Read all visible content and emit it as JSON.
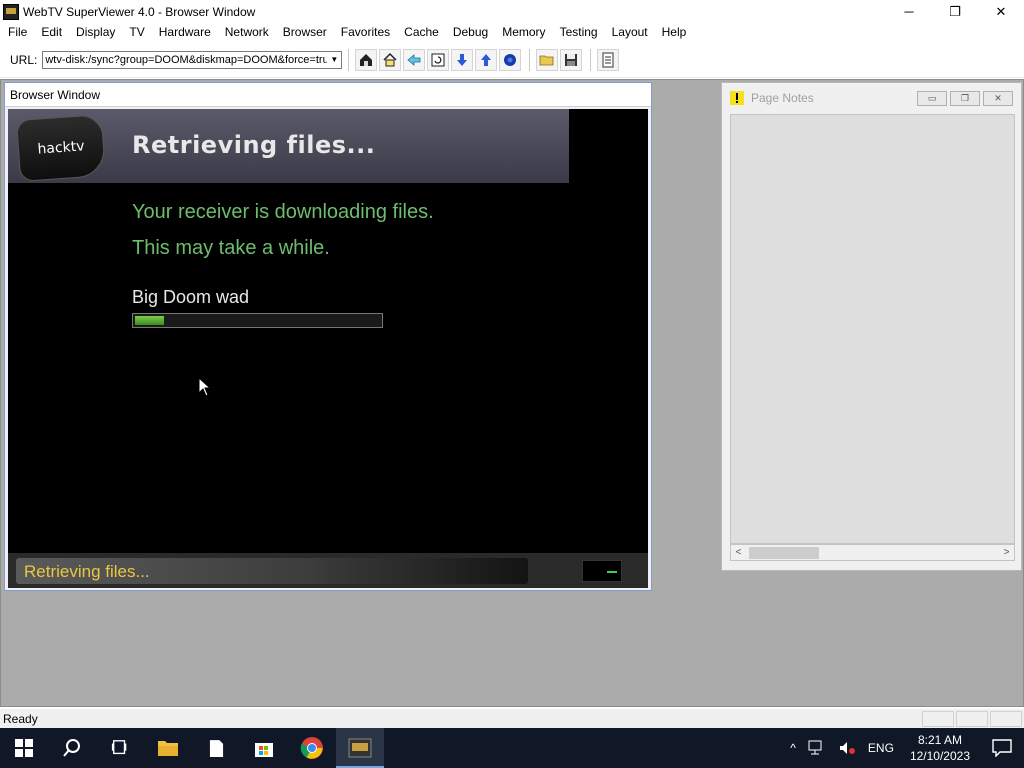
{
  "window": {
    "title": "WebTV SuperViewer 4.0 - Browser Window",
    "minimize_glyph": "─",
    "maximize_glyph": "❐",
    "close_glyph": "✕"
  },
  "menu": [
    "File",
    "Edit",
    "Display",
    "TV",
    "Hardware",
    "Network",
    "Browser",
    "Favorites",
    "Cache",
    "Debug",
    "Memory",
    "Testing",
    "Layout",
    "Help"
  ],
  "toolbar": {
    "url_label": "URL:",
    "url_value": "wtv-disk:/sync?group=DOOM&diskmap=DOOM&force=true",
    "icons": [
      "home-folder-icon",
      "home-icon",
      "back-arrow-icon",
      "reload-icon",
      "down-arrow-icon",
      "up-arrow-icon",
      "stop-icon",
      "open-folder-icon",
      "save-icon",
      "page-source-icon"
    ]
  },
  "browser_window": {
    "title": "Browser Window",
    "logo_text": "hacktv",
    "banner_title": "Retrieving files...",
    "message_line1": "Your receiver is downloading files.",
    "message_line2": "This may take a while.",
    "file_name": "Big Doom wad",
    "progress_fraction": 0.12,
    "status_text": "Retrieving files..."
  },
  "page_notes": {
    "title": "Page Notes",
    "scroll_left": "<",
    "scroll_right": ">"
  },
  "status_bar": {
    "text": "Ready"
  },
  "taskbar": {
    "apps": [
      "start-icon",
      "search-icon",
      "task-view-icon",
      "file-explorer-icon",
      "notepad-icon",
      "store-icon",
      "chrome-icon",
      "webtv-viewer-icon"
    ],
    "language": "ENG",
    "time": "8:21 AM",
    "date": "12/10/2023",
    "tray_chevron": "^"
  },
  "colors": {
    "tv_green_text": "#6ebc6e",
    "tv_status_yellow": "#e8c840",
    "taskbar_bg": "#101828"
  }
}
